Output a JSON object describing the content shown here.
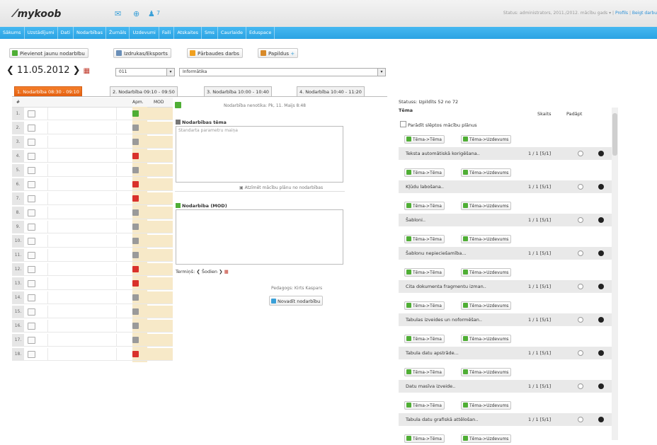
{
  "header": {
    "logo": "mykoob",
    "notification_count": "7",
    "status_text": "Status: administrators, 2011./2012. mācību gads",
    "profile_link": "Profils",
    "logout_link": "Beigt darbu"
  },
  "nav": {
    "items": [
      "Sākums",
      "Uzstādījumi",
      "Dati",
      "Nodarbības",
      "Žurnāls",
      "Uzdevumi",
      "Faili",
      "Atskaites",
      "Sms",
      "Caurlaide",
      "Eduspace"
    ]
  },
  "toolbar": {
    "add_label": "Pievienot jaunu nodarbību",
    "print_label": "Izdrukas/Eksports",
    "test_label": "Pārbaudes darbs",
    "extra_label": "Papildus"
  },
  "date": {
    "value": "11.05.2012",
    "class_select": "011",
    "subject_select": "Informātika"
  },
  "tabs": [
    "1. Nodarbība 08:30 - 09:10",
    "2. Nodarbība 09:10 - 09:50",
    "3. Nodarbība 10:00 - 10:40",
    "4. Nodarbība 10:40 - 11:20"
  ],
  "table": {
    "col_num": "#",
    "col_apm": "Apm.",
    "col_moo": "MOD",
    "rows": [
      {
        "num": "1.",
        "apm": "g"
      },
      {
        "num": "2.",
        "apm": "gr"
      },
      {
        "num": "3.",
        "apm": "gr"
      },
      {
        "num": "4.",
        "apm": "r"
      },
      {
        "num": "5.",
        "apm": "gr"
      },
      {
        "num": "6.",
        "apm": "r"
      },
      {
        "num": "7.",
        "apm": "r"
      },
      {
        "num": "8.",
        "apm": "gr"
      },
      {
        "num": "9.",
        "apm": "gr"
      },
      {
        "num": "10.",
        "apm": "gr"
      },
      {
        "num": "11.",
        "apm": "gr"
      },
      {
        "num": "12.",
        "apm": "r"
      },
      {
        "num": "13.",
        "apm": "r"
      },
      {
        "num": "14.",
        "apm": "gr"
      },
      {
        "num": "15.",
        "apm": "gr"
      },
      {
        "num": "16.",
        "apm": "gr"
      },
      {
        "num": "17.",
        "apm": "gr"
      },
      {
        "num": "18.",
        "apm": "r"
      }
    ]
  },
  "lesson": {
    "header_note": "Nodarbība nenotika: Pk, 11. Maijs 8:48",
    "topic_title": "Nodarbības tēma",
    "topic_placeholder": "Standarta parametru maiņa",
    "select_from_plan": "Atzīmēt mācību plānu no nodarbības",
    "homework_title": "Nodarbība (MOD)",
    "deadline_label": "Termiņš:",
    "today_label": "Šodien",
    "teacher": "Pedagogs: Kirts Kaspars",
    "save_button": "Novadīt nodarbību"
  },
  "right": {
    "status": "Statuss: Izpildīts 52 no 72",
    "col_topic": "Tēma",
    "col_count": "Skaits",
    "col_pad": "Padāpt",
    "show_hidden": "Parādīt slēptos mācību plānus",
    "btn_topic": "Tēma->Tēma",
    "btn_task": "Tēma->Uzdevums",
    "topics": [
      {
        "name": "Teksta automātiskā korigēšana..",
        "count": "1 / 1 [5/1]"
      },
      {
        "name": "Kļūdu labošana..",
        "count": "1 / 1 [5/1]"
      },
      {
        "name": "Šabloni..",
        "count": "1 / 1 [5/1]"
      },
      {
        "name": "Šablonu nepieciešamība...",
        "count": "1 / 1 [5/1]"
      },
      {
        "name": "Cita dokumenta fragmentu izman..",
        "count": "1 / 1 [5/1]"
      },
      {
        "name": "Tabulas izveides un noformēšan..",
        "count": "1 / 1 [5/1]"
      },
      {
        "name": "Tabula datu apstrāde...",
        "count": "1 / 1 [5/1]"
      },
      {
        "name": "Datu masīva izveide..",
        "count": "1 / 1 [5/1]"
      },
      {
        "name": "Tabula datu grafiskā attēlošan..",
        "count": "1 / 1 [5/1]"
      }
    ]
  }
}
